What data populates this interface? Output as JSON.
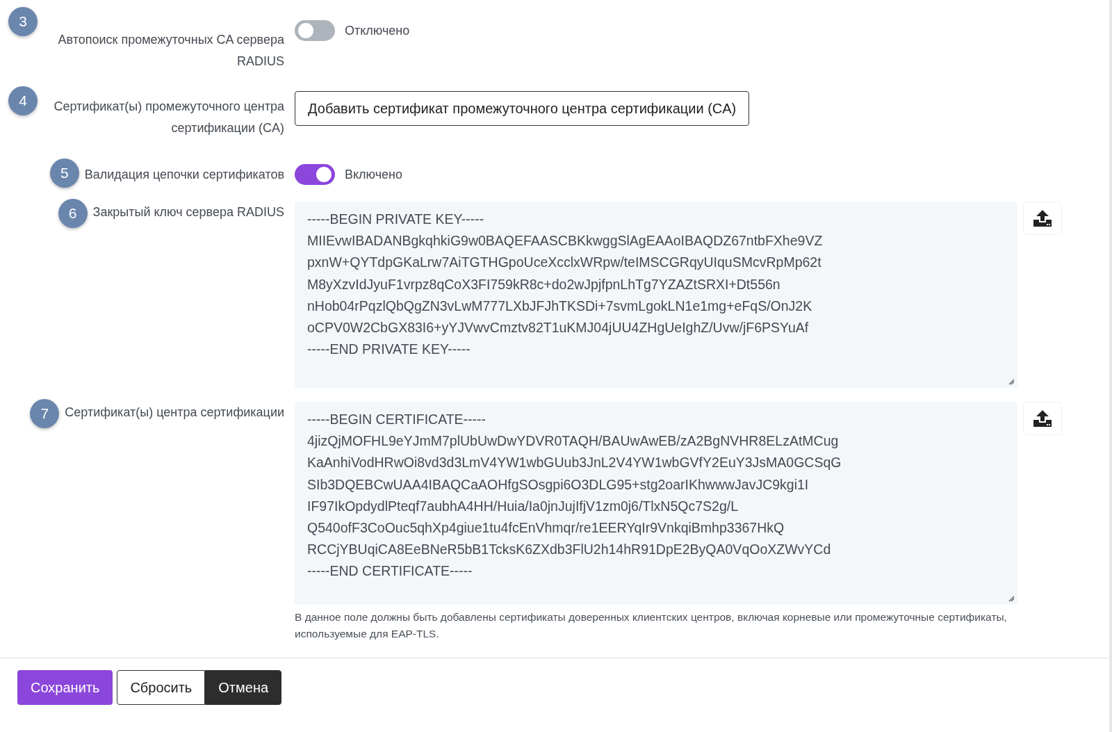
{
  "rows": [
    {
      "number": "3",
      "label": "Автопоиск промежуточных CA сервера RADIUS",
      "kind": "toggle",
      "on": false,
      "state_text": "Отключено"
    },
    {
      "number": "4",
      "label": "Сертификат(ы) промежуточного центра сертификации (CA)",
      "kind": "button",
      "button": "Добавить сертификат промежуточного центра сертификации (CA)"
    },
    {
      "number": "5",
      "label": "Валидация цепочки сертификатов",
      "kind": "toggle",
      "on": true,
      "state_text": "Включено"
    },
    {
      "number": "6",
      "label": "Закрытый ключ сервера RADIUS",
      "kind": "textarea",
      "lines": [
        "-----BEGIN PRIVATE KEY-----",
        "MIIEvwIBADANBgkqhkiG9w0BAQEFAASCBKkwggSlAgEAAoIBAQDZ67ntbFXhe9VZ",
        "pxnW+QYTdpGKaLrw7AiTGTHGpoUceXcclxWRpw/teIMSCGRqyUIquSMcvRpMp62t",
        "M8yXzvIdJyuF1vrpz8qCoX3FI759kR8c+do2wJpjfpnLhTg7YZAZtSRXI+Dt556n",
        "nHob04rPqzlQbQgZN3vLwM777LXbJFJhTKSDi+7svmLgokLN1e1mg+eFqS/OnJ2K",
        "oCPV0W2CbGX83I6+yYJVwvCmztv82T1uKMJ04jUU4ZHgUeIghZ/Uvw/jF6PSYuAf",
        "-----END PRIVATE KEY-----"
      ]
    },
    {
      "number": "7",
      "label": "Сертификат(ы) центра сертификации",
      "kind": "textarea",
      "lines": [
        "-----BEGIN CERTIFICATE-----",
        "4jizQjMOFHL9eYJmM7plUbUwDwYDVR0TAQH/BAUwAwEB/zA2BgNVHR8ELzAtMCug",
        "KaAnhiVodHRwOi8vd3d3LmV4YW1wbGUub3JnL2V4YW1wbGVfY2EuY3JsMA0GCSqG",
        "SIb3DQEBCwUAA4IBAQCaAOHfgSOsgpi6O3DLG95+stg2oarIKhwwwJavJC9kgi1I",
        "IF97IkOpdydlPteqf7aubhA4HH/Huia/Ia0jnJujIfjV1zm0j6/TlxN5Qc7S2g/L",
        "Q540ofF3CoOuc5qhXp4giue1tu4fcEnVhmqr/re1EERYqIr9VnkqiBmhp3367HkQ",
        "RCCjYBUqiCA8EeBNeR5bB1TcksK6ZXdb3FlU2h14hR91DpE2ByQA0VqOoXZWvYCd",
        "-----END CERTIFICATE-----"
      ],
      "help": "В данное поле должны быть добавлены сертификаты доверенных клиентских центров, включая корневые или промежуточные сертификаты, используемые для EAP-TLS."
    }
  ],
  "buttons": [
    {
      "label": "Сохранить",
      "kind": "primary"
    },
    {
      "label": "Сбросить",
      "kind": "outline"
    },
    {
      "label": "Отмена",
      "kind": "dark"
    }
  ]
}
